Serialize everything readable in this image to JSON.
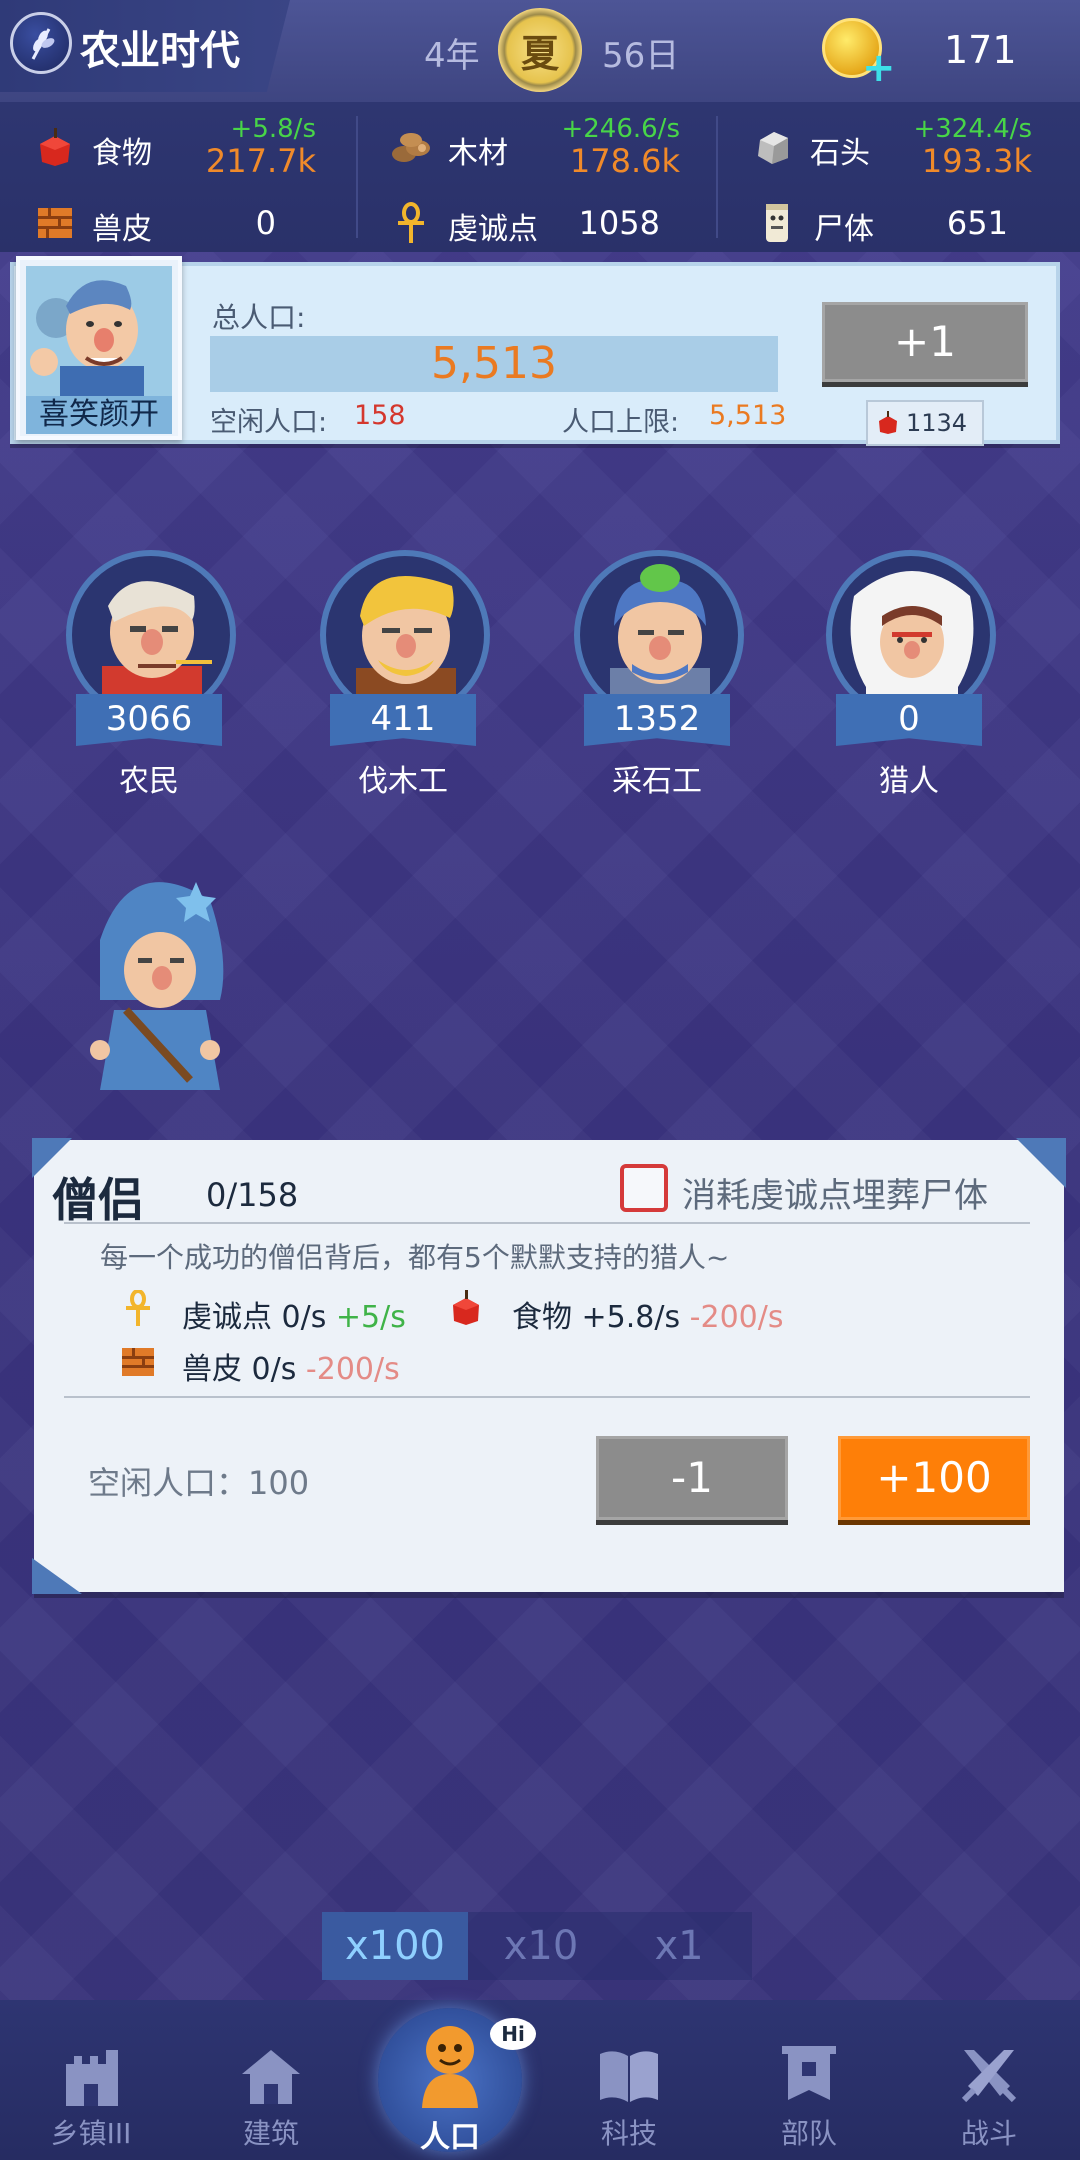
{
  "header": {
    "era_title": "农业时代",
    "year": "4年",
    "season": "夏",
    "day": "56日",
    "coins": "171"
  },
  "resources": [
    {
      "name": "食物",
      "icon": "apple-icon",
      "rate": "+5.8/s",
      "amount": "217.7k"
    },
    {
      "name": "木材",
      "icon": "wood-icon",
      "rate": "+246.6/s",
      "amount": "178.6k"
    },
    {
      "name": "石头",
      "icon": "stone-icon",
      "rate": "+324.4/s",
      "amount": "193.3k"
    },
    {
      "name": "兽皮",
      "icon": "hide-icon",
      "value": "0"
    },
    {
      "name": "虔诚点",
      "icon": "ankh-icon",
      "value": "1058"
    },
    {
      "name": "尸体",
      "icon": "corpse-icon",
      "value": "651"
    }
  ],
  "population": {
    "leader_name": "喜笑颜开",
    "total_label": "总人口:",
    "total": "5,513",
    "idle_label": "空闲人口:",
    "idle": "158",
    "cap_label": "人口上限:",
    "cap": "5,513",
    "add_label": "+1",
    "add_cost": "1134"
  },
  "workers": [
    {
      "name": "农民",
      "count": "3066"
    },
    {
      "name": "伐木工",
      "count": "411"
    },
    {
      "name": "采石工",
      "count": "1352"
    },
    {
      "name": "猎人",
      "count": "0"
    }
  ],
  "card": {
    "title": "僧侣",
    "count": "0/158",
    "burial_label": "消耗虔诚点埋葬尸体",
    "description": "每一个成功的僧侣背后，都有5个默默支持的猎人~",
    "effect_piety_label": "虔诚点 0/s",
    "effect_piety_delta": "+5/s",
    "effect_food_label": "食物 +5.8/s",
    "effect_food_delta": "-200/s",
    "effect_hide_label": "兽皮 0/s",
    "effect_hide_delta": "-200/s",
    "idle_text": "空闲人口：100",
    "minus_label": "-1",
    "plus_label": "+100"
  },
  "multiplier": {
    "options": [
      "x100",
      "x10",
      "x1"
    ],
    "active": "x100"
  },
  "nav": [
    {
      "label": "乡镇III",
      "icon": "castle-icon"
    },
    {
      "label": "建筑",
      "icon": "house-icon"
    },
    {
      "label": "人口",
      "icon": "person-icon"
    },
    {
      "label": "科技",
      "icon": "book-icon"
    },
    {
      "label": "部队",
      "icon": "banner-icon"
    },
    {
      "label": "战斗",
      "icon": "swords-icon"
    }
  ],
  "nav_bubble": "Hi",
  "colors": {
    "accent_orange": "#fe7f08",
    "positive_green": "#48d548",
    "amount_orange": "#f08a2a",
    "negative_red": "#d4372d"
  }
}
